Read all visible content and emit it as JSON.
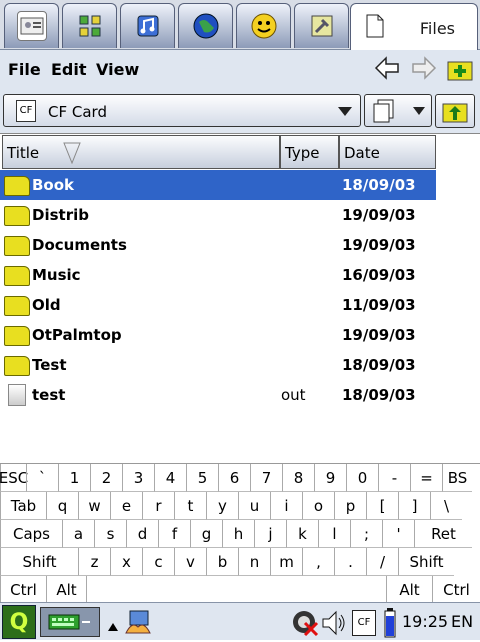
{
  "tabs": [
    {
      "name": "contact-icon",
      "glyph": "👤"
    },
    {
      "name": "apps-icon",
      "glyph": "▦"
    },
    {
      "name": "music-icon",
      "glyph": "♫"
    },
    {
      "name": "globe-icon",
      "glyph": "🌐"
    },
    {
      "name": "smiley-icon",
      "glyph": "☺"
    },
    {
      "name": "settings-icon",
      "glyph": "🔧"
    }
  ],
  "active_tab": {
    "label": "Files"
  },
  "menu": {
    "file": "File",
    "edit": "Edit",
    "view": "View"
  },
  "location": {
    "value": "CF Card",
    "icon": "CF"
  },
  "columns": {
    "title": "Title",
    "type": "Type",
    "date": "Date"
  },
  "files": [
    {
      "name": "Book",
      "type": "",
      "date": "18/09/03",
      "kind": "folder",
      "selected": true
    },
    {
      "name": "Distrib",
      "type": "",
      "date": "19/09/03",
      "kind": "folder",
      "selected": false
    },
    {
      "name": "Documents",
      "type": "",
      "date": "19/09/03",
      "kind": "folder",
      "selected": false
    },
    {
      "name": "Music",
      "type": "",
      "date": "16/09/03",
      "kind": "folder",
      "selected": false
    },
    {
      "name": "Old",
      "type": "",
      "date": "11/09/03",
      "kind": "folder",
      "selected": false
    },
    {
      "name": "OtPalmtop",
      "type": "",
      "date": "19/09/03",
      "kind": "folder",
      "selected": false
    },
    {
      "name": "Test",
      "type": "",
      "date": "18/09/03",
      "kind": "folder",
      "selected": false
    },
    {
      "name": "test",
      "type": "out",
      "date": "18/09/03",
      "kind": "file",
      "selected": false
    }
  ],
  "keyboard": [
    [
      "ESC",
      "`",
      "1",
      "2",
      "3",
      "4",
      "5",
      "6",
      "7",
      "8",
      "9",
      "0",
      "-",
      "=",
      "BS"
    ],
    [
      "Tab",
      "q",
      "w",
      "e",
      "r",
      "t",
      "y",
      "u",
      "i",
      "o",
      "p",
      "[",
      "]",
      "\\"
    ],
    [
      "Caps",
      "a",
      "s",
      "d",
      "f",
      "g",
      "h",
      "j",
      "k",
      "l",
      ";",
      "'",
      "Ret"
    ],
    [
      "Shift",
      "z",
      "x",
      "c",
      "v",
      "b",
      "n",
      "m",
      ",",
      ".",
      "/",
      "Shift"
    ],
    [
      "Ctrl",
      "Alt",
      "Alt",
      "Ctrl"
    ]
  ],
  "taskbar": {
    "time": "19:25",
    "lang": "EN",
    "cf": "CF",
    "q": "Q"
  }
}
